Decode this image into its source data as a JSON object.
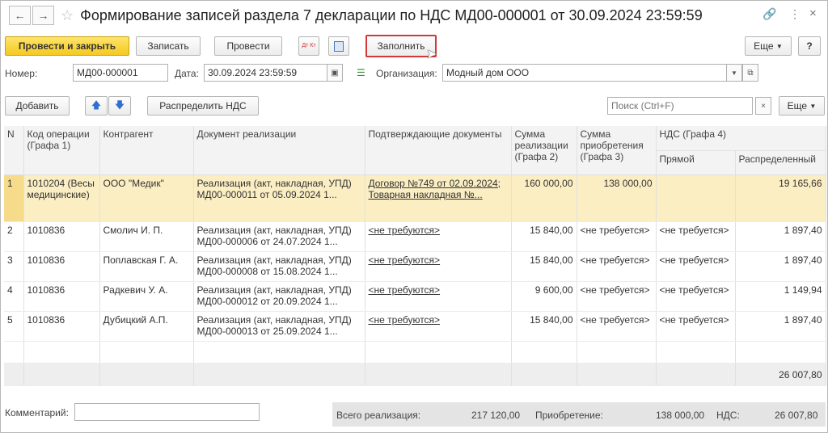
{
  "window": {
    "title": "Формирование записей раздела 7 декларации по НДС МД00-000001 от 30.09.2024 23:59:59"
  },
  "toolbar": {
    "post_close": "Провести и закрыть",
    "write": "Записать",
    "post": "Провести",
    "dt_kt_icon": "Дт Кт",
    "fill": "Заполнить",
    "more": "Еще",
    "help": "?"
  },
  "header": {
    "number_label": "Номер:",
    "number_value": "МД00-000001",
    "date_label": "Дата:",
    "date_value": "30.09.2024 23:59:59",
    "org_label": "Организация:",
    "org_value": "Модный дом ООО"
  },
  "table_toolbar": {
    "add": "Добавить",
    "distribute": "Распределить НДС",
    "search_placeholder": "Поиск (Ctrl+F)",
    "clear": "×",
    "more": "Еще"
  },
  "columns": {
    "n": "N",
    "code": "Код операции (Графа 1)",
    "contractor": "Контрагент",
    "doc": "Документ реализации",
    "confirm": "Подтверждающие документы",
    "sum_sale": "Сумма реализации (Графа 2)",
    "sum_buy": "Сумма приобретения (Графа 3)",
    "vat": "НДС (Графа 4)",
    "vat_direct": "Прямой",
    "vat_dist": "Распределенный"
  },
  "rows": [
    {
      "n": "1",
      "code": "1010204 (Весы медицинские)",
      "contractor": "ООО \"Медик\"",
      "doc": "Реализация (акт, накладная, УПД) МД00-000011 от 05.09.2024 1...",
      "confirm": "Договор №749 от 02.09.2024; Товарная накладная №...",
      "sale": "160 000,00",
      "buy": "138 000,00",
      "direct": "",
      "dist": "19 165,66"
    },
    {
      "n": "2",
      "code": "1010836",
      "contractor": "Смолич И. П.",
      "doc": "Реализация (акт, накладная, УПД) МД00-000006 от 24.07.2024 1...",
      "confirm": "<не требуются>",
      "sale": "15 840,00",
      "buy": "<не требуется>",
      "direct": "<не требуется>",
      "dist": "1 897,40"
    },
    {
      "n": "3",
      "code": "1010836",
      "contractor": "Поплавская Г. А.",
      "doc": "Реализация (акт, накладная, УПД) МД00-000008 от 15.08.2024 1...",
      "confirm": "<не требуются>",
      "sale": "15 840,00",
      "buy": "<не требуется>",
      "direct": "<не требуется>",
      "dist": "1 897,40"
    },
    {
      "n": "4",
      "code": "1010836",
      "contractor": "Радкевич У. А.",
      "doc": "Реализация (акт, накладная, УПД) МД00-000012 от 20.09.2024 1...",
      "confirm": "<не требуются>",
      "sale": "9 600,00",
      "buy": "<не требуется>",
      "direct": "<не требуется>",
      "dist": "1 149,94"
    },
    {
      "n": "5",
      "code": "1010836",
      "contractor": "Дубицкий А.П.",
      "doc": "Реализация (акт, накладная, УПД) МД00-000013 от 25.09.2024 1...",
      "confirm": "<не требуются>",
      "sale": "15 840,00",
      "buy": "<не требуется>",
      "direct": "<не требуется>",
      "dist": "1 897,40"
    }
  ],
  "totals_row": {
    "dist": "26 007,80"
  },
  "comment_label": "Комментарий:",
  "footer": {
    "total_sale_label": "Всего реализация:",
    "total_sale": "217 120,00",
    "purchase_label": "Приобретение:",
    "purchase": "138 000,00",
    "vat_label": "НДС:",
    "vat": "26 007,80"
  }
}
